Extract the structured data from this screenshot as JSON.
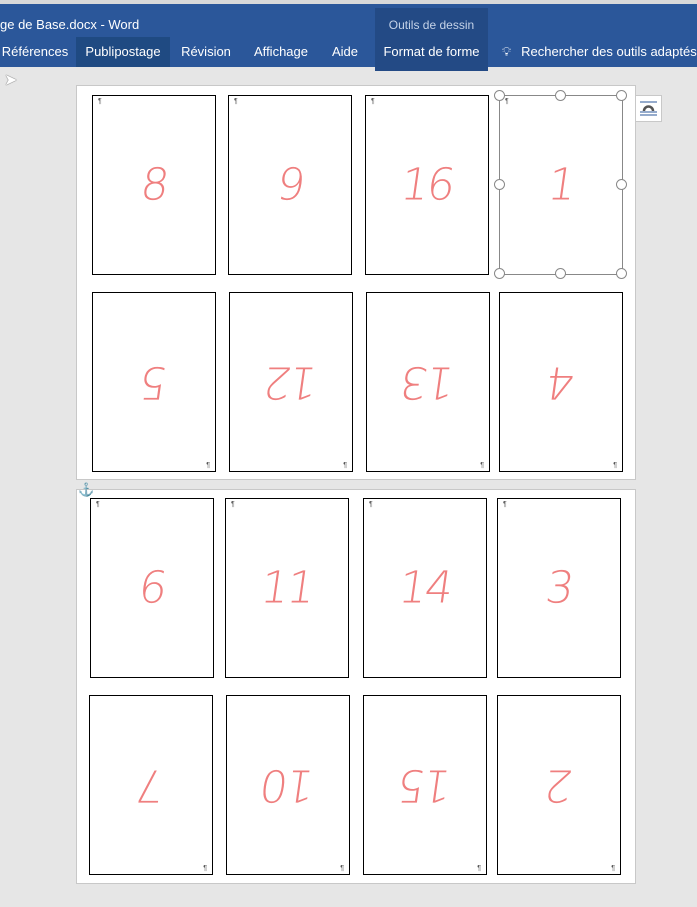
{
  "window": {
    "title": "ge de Base.docx  -  Word"
  },
  "ribbon": {
    "context_group": "Outils de dessin",
    "tabs": [
      {
        "label": "Références",
        "active": false
      },
      {
        "label": "Publipostage",
        "active": true
      },
      {
        "label": "Révision",
        "active": false
      },
      {
        "label": "Affichage",
        "active": false
      },
      {
        "label": "Aide",
        "active": false
      },
      {
        "label": "Format de forme",
        "active": false
      }
    ],
    "search": {
      "icon": "lightbulb-icon",
      "label": "Rechercher des outils adaptés"
    }
  },
  "document": {
    "pages": [
      {
        "rows": [
          {
            "flipped": false,
            "numbers": [
              "8",
              "9",
              "16",
              "1"
            ]
          },
          {
            "flipped": true,
            "numbers": [
              "5",
              "12",
              "13",
              "4"
            ]
          }
        ]
      },
      {
        "rows": [
          {
            "flipped": false,
            "numbers": [
              "6",
              "11",
              "14",
              "3"
            ]
          },
          {
            "flipped": true,
            "numbers": [
              "7",
              "10",
              "15",
              "2"
            ]
          }
        ]
      }
    ],
    "selected_card": "1",
    "number_color": "#ef7f7f",
    "accent": "#2b579a"
  }
}
